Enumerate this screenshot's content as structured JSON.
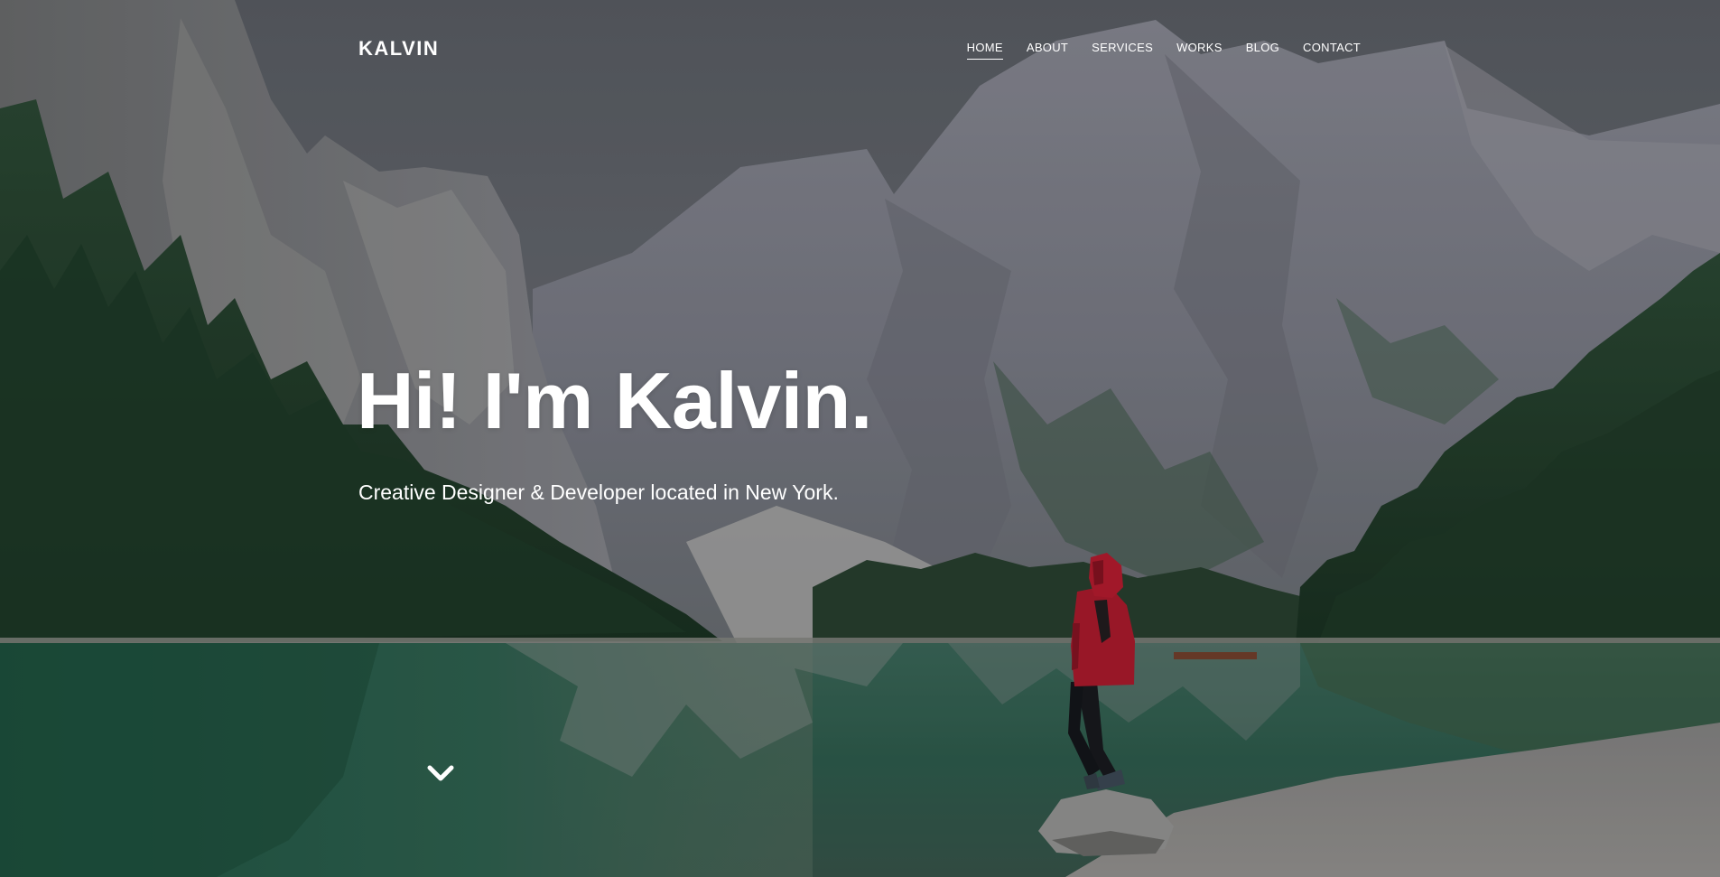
{
  "header": {
    "logo": "KALVIN"
  },
  "nav": {
    "items": [
      {
        "label": "HOME",
        "active": true
      },
      {
        "label": "ABOUT",
        "active": false
      },
      {
        "label": "SERVICES",
        "active": false
      },
      {
        "label": "WORKS",
        "active": false
      },
      {
        "label": "BLOG",
        "active": false
      },
      {
        "label": "CONTACT",
        "active": false
      }
    ]
  },
  "hero": {
    "title": "Hi! I'm Kalvin.",
    "subtitle": "Creative Designer & Developer located in New York.",
    "scroll_icon": "chevron-down-icon"
  },
  "colors": {
    "text": "#ffffff",
    "jacket": "#b5182a",
    "water": "#2f6a55",
    "forest": "#1f3b28",
    "rock": "#8c8e96"
  }
}
